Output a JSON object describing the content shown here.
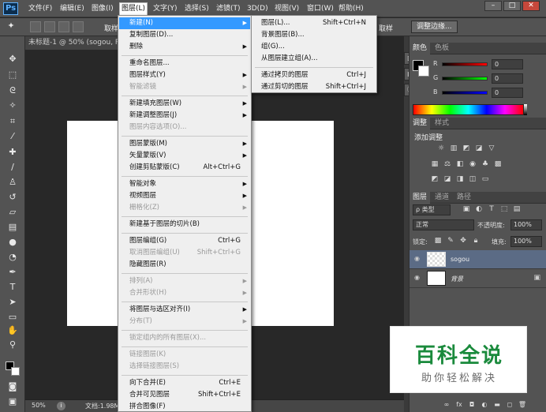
{
  "app": {
    "logo": "Ps"
  },
  "menubar": {
    "items": [
      {
        "label": "文件(F)"
      },
      {
        "label": "编辑(E)"
      },
      {
        "label": "图像(I)"
      },
      {
        "label": "图层(L)"
      },
      {
        "label": "文字(Y)"
      },
      {
        "label": "选择(S)"
      },
      {
        "label": "滤镜(T)"
      },
      {
        "label": "3D(D)"
      },
      {
        "label": "视图(V)"
      },
      {
        "label": "窗口(W)"
      },
      {
        "label": "帮助(H)"
      }
    ],
    "window_controls": {
      "minimize": "–",
      "restore": "□",
      "close": "✕"
    }
  },
  "options_bar": {
    "left_label": "取样",
    "right_label": "取样",
    "adjust_edge": "调整边缘..."
  },
  "document": {
    "tab": "未标题-1 @ 50% (sogou, RG"
  },
  "status": {
    "zoom": "50%",
    "doc_info": "文档:1.98M"
  },
  "layer_menu": {
    "items": [
      {
        "label": "新建(N)",
        "arrow": "▶"
      },
      {
        "label": "复制图层(D)..."
      },
      {
        "label": "删除",
        "arrow": "▶"
      },
      {
        "label": "重命名图层..."
      },
      {
        "label": "图层样式(Y)",
        "arrow": "▶"
      },
      {
        "label": "智能滤镜",
        "arrow": "▶"
      },
      {
        "label": "新建填充图层(W)",
        "arrow": "▶"
      },
      {
        "label": "新建调整图层(J)",
        "arrow": "▶"
      },
      {
        "label": "图层内容选项(O)..."
      },
      {
        "label": "图层蒙版(M)",
        "arrow": "▶"
      },
      {
        "label": "矢量蒙版(V)",
        "arrow": "▶"
      },
      {
        "label": "创建剪贴蒙版(C)",
        "shortcut": "Alt+Ctrl+G"
      },
      {
        "label": "智能对象",
        "arrow": "▶"
      },
      {
        "label": "视频图层",
        "arrow": "▶"
      },
      {
        "label": "栅格化(Z)",
        "arrow": "▶"
      },
      {
        "label": "新建基于图层的切片(B)"
      },
      {
        "label": "图层编组(G)",
        "shortcut": "Ctrl+G"
      },
      {
        "label": "取消图层编组(U)",
        "shortcut": "Shift+Ctrl+G"
      },
      {
        "label": "隐藏图层(R)"
      },
      {
        "label": "排列(A)",
        "arrow": "▶"
      },
      {
        "label": "合并形状(H)",
        "arrow": "▶"
      },
      {
        "label": "将图层与选区对齐(I)",
        "arrow": "▶"
      },
      {
        "label": "分布(T)",
        "arrow": "▶"
      },
      {
        "label": "锁定组内的所有图层(X)..."
      },
      {
        "label": "链接图层(K)"
      },
      {
        "label": "选择链接图层(S)"
      },
      {
        "label": "向下合并(E)",
        "shortcut": "Ctrl+E"
      },
      {
        "label": "合并可见图层",
        "shortcut": "Shift+Ctrl+E"
      },
      {
        "label": "拼合图像(F)"
      }
    ]
  },
  "new_submenu": {
    "items": [
      {
        "label": "图层(L)...",
        "shortcut": "Shift+Ctrl+N"
      },
      {
        "label": "背景图层(B)..."
      },
      {
        "label": "组(G)..."
      },
      {
        "label": "从图层建立组(A)..."
      },
      {
        "label": "通过拷贝的图层",
        "shortcut": "Ctrl+J"
      },
      {
        "label": "通过剪切的图层",
        "shortcut": "Shift+Ctrl+J"
      }
    ]
  },
  "color_panel": {
    "tabs": [
      "颜色",
      "色板"
    ],
    "channels": [
      {
        "label": "R",
        "value": "0"
      },
      {
        "label": "G",
        "value": "0"
      },
      {
        "label": "B",
        "value": "0"
      }
    ]
  },
  "adjust_panel": {
    "tabs": [
      "调整",
      "样式"
    ],
    "title": "添加调整"
  },
  "layers_panel": {
    "tabs": [
      "图层",
      "通道",
      "路径"
    ],
    "filter": "ρ 类型",
    "blend_mode": "正常",
    "opacity_label": "不透明度:",
    "opacity_value": "100%",
    "lock_label": "锁定:",
    "fill_label": "填充:",
    "fill_value": "100%",
    "layers": [
      {
        "name": "sogou"
      },
      {
        "name": "背景"
      }
    ]
  },
  "watermark": {
    "title": "百科全说",
    "subtitle": "助你轻松解决"
  },
  "colors": {
    "accent_blue": "#3399ff",
    "selected_layer": "#5b6b85",
    "watermark_green": "#1a8a3c"
  }
}
